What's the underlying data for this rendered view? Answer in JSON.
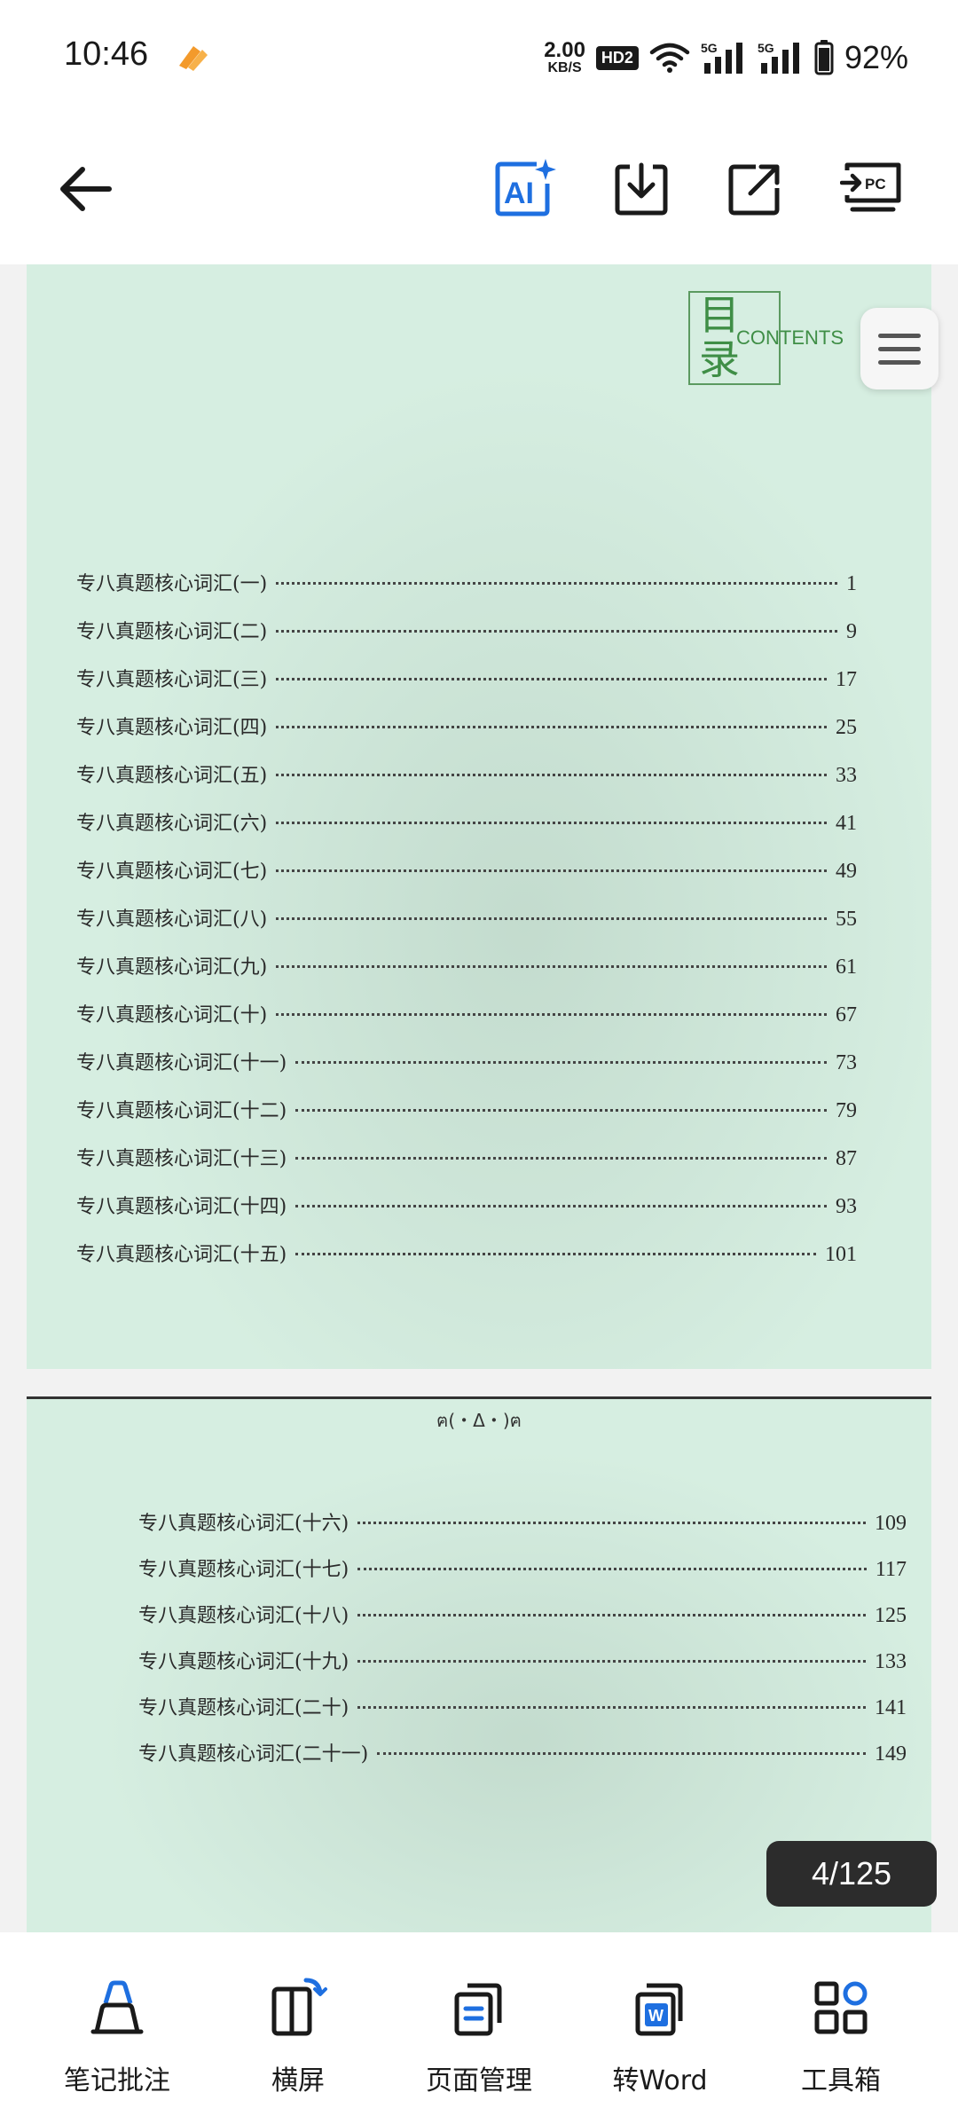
{
  "status_bar": {
    "time": "10:46",
    "net_speed_value": "2.00",
    "net_speed_unit": "KB/S",
    "hd_badge": "HD2",
    "signal_1": "5G",
    "signal_2": "5G",
    "battery": "92%"
  },
  "toolbar": {
    "back_icon": "arrow-left-icon",
    "ai_label": "AI",
    "accent_color": "#1e6fe0"
  },
  "page1": {
    "logo_mu": "目",
    "logo_lu": "录",
    "logo_contents": "CONTENTS",
    "toc": [
      {
        "title": "专八真题核心词汇(一)",
        "page": "1"
      },
      {
        "title": "专八真题核心词汇(二)",
        "page": "9"
      },
      {
        "title": "专八真题核心词汇(三)",
        "page": "17"
      },
      {
        "title": "专八真题核心词汇(四)",
        "page": "25"
      },
      {
        "title": "专八真题核心词汇(五)",
        "page": "33"
      },
      {
        "title": "专八真题核心词汇(六)",
        "page": "41"
      },
      {
        "title": "专八真题核心词汇(七)",
        "page": "49"
      },
      {
        "title": "专八真题核心词汇(八)",
        "page": "55"
      },
      {
        "title": "专八真题核心词汇(九)",
        "page": "61"
      },
      {
        "title": "专八真题核心词汇(十)",
        "page": "67"
      },
      {
        "title": "专八真题核心词汇(十一)",
        "page": "73"
      },
      {
        "title": "专八真题核心词汇(十二)",
        "page": "79"
      },
      {
        "title": "专八真题核心词汇(十三)",
        "page": "87"
      },
      {
        "title": "专八真题核心词汇(十四)",
        "page": "93"
      },
      {
        "title": "专八真题核心词汇(十五)",
        "page": "101"
      }
    ]
  },
  "page2": {
    "header": "ฅ(・Δ・)ฅ",
    "toc": [
      {
        "title": "专八真题核心词汇(十六)",
        "page": "109"
      },
      {
        "title": "专八真题核心词汇(十七)",
        "page": "117"
      },
      {
        "title": "专八真题核心词汇(十八)",
        "page": "125"
      },
      {
        "title": "专八真题核心词汇(十九)",
        "page": "133"
      },
      {
        "title": "专八真题核心词汇(二十)",
        "page": "141"
      },
      {
        "title": "专八真题核心词汇(二十一)",
        "page": "149"
      }
    ]
  },
  "page_indicator": "4/125",
  "bottom_bar": {
    "items": [
      {
        "label": "笔记批注",
        "icon": "highlighter-icon"
      },
      {
        "label": "横屏",
        "icon": "rotate-screen-icon"
      },
      {
        "label": "页面管理",
        "icon": "pages-icon"
      },
      {
        "label": "转Word",
        "icon": "word-convert-icon"
      },
      {
        "label": "工具箱",
        "icon": "toolbox-icon"
      }
    ]
  }
}
